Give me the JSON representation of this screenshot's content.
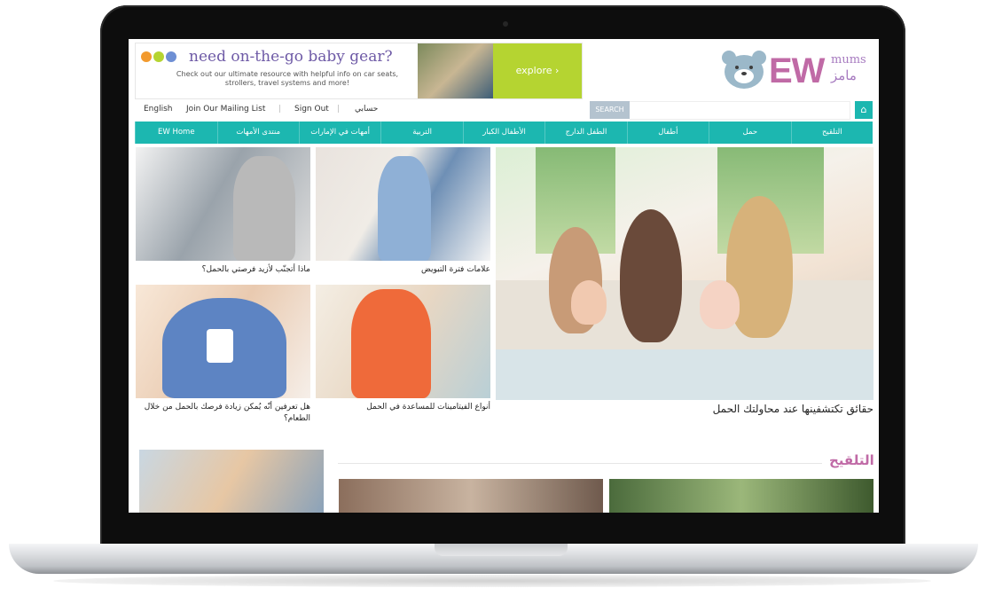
{
  "ad": {
    "title": "need on-the-go baby gear?",
    "subtitle": "Check out our ultimate resource with helpful info on car seats, strollers, travel systems and more!",
    "cta": "explore ›"
  },
  "logo": {
    "ew": "EW",
    "mums": "mums",
    "arabic": "مامز"
  },
  "util": {
    "english": "English",
    "mailing": "Join Our Mailing List",
    "signout": "Sign Out",
    "account": "حسابي",
    "search": "SEARCH",
    "home_icon": "⌂"
  },
  "nav": [
    "التلقيح",
    "حمل",
    "أطفال",
    "الطفل الدارج",
    "الأطفال الكبار",
    "التربية",
    "أمهات في الإمارات",
    "منتدى الأمهات",
    "EW Home"
  ],
  "hero": {
    "caption": "حقائق تكتشفينها عند محاولتك الحمل"
  },
  "thumbs": [
    {
      "caption": "ماذا أتجنّب لأزيد فرصتي بالحمل؟"
    },
    {
      "caption": "علامات فترة التبويض"
    },
    {
      "caption": "هل تعرفين أنّه يُمكن زيادة فرصك بالحمل من خلال الطعام؟"
    },
    {
      "caption": "أنواع الفيتامينات للمساعدة في الحمل"
    }
  ],
  "section": {
    "title": "التلقيح"
  },
  "colors": {
    "teal": "#1cb7b0",
    "pink": "#c06aa6",
    "lime": "#b5d431"
  }
}
